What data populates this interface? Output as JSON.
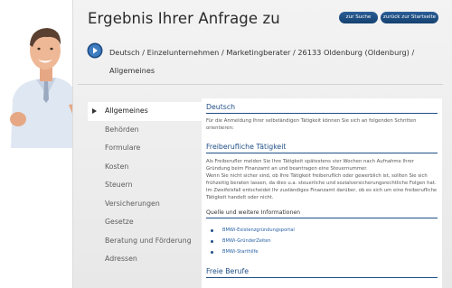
{
  "title": "Ergebnis Ihrer Anfrage zu",
  "buttons": {
    "search": "zur Suche",
    "home": "zurück zur Startseite"
  },
  "breadcrumb": {
    "line1": "Deutsch / Einzelunternehmen / Marketingberater / 26133 Oldenburg (Oldenburg) /",
    "line2": "Allgemeines"
  },
  "nav": {
    "items": [
      {
        "label": "Allgemeines",
        "active": true
      },
      {
        "label": "Behörden"
      },
      {
        "label": "Formulare"
      },
      {
        "label": "Kosten"
      },
      {
        "label": "Steuern"
      },
      {
        "label": "Versicherungen"
      },
      {
        "label": "Gesetze"
      },
      {
        "label": "Beratung und Förderung"
      },
      {
        "label": "Adressen"
      }
    ]
  },
  "content": {
    "section1": {
      "heading": "Deutsch",
      "text": "Für die Anmeldung Ihrer selbständigen Tätigkeit können Sie sich an folgenden Schritten orientieren:"
    },
    "section2": {
      "heading": "Freiberufliche Tätigkeit",
      "text1": "Als Freiberufler melden Sie Ihre Tätigkeit spätestens vier Wochen nach Aufnahme Ihrer Gründung beim Finanzamt an und beantragen eine Steuernummer.",
      "text2": "Wenn Sie nicht sicher sind, ob Ihre Tätigkeit freiberuflich oder gewerblich ist, sollten Sie sich frühzeitig beraten lassen, da dies u.a. steuerliche und sozialversicherungsrechtliche Folgen hat. Im Zweifelsfall entscheidet Ihr zuständiges Finanzamt darüber, ob es sich um eine freiberufliche Tätigkeit handelt oder nicht."
    },
    "section3": {
      "heading": "Quelle und weitere Informationen",
      "links": [
        "BMWi-Existenzgründungsportal",
        "BMWi-GründerZeiten",
        "BMWi-Starthilfe"
      ]
    },
    "section4": {
      "heading": "Freie Berufe"
    }
  },
  "colors": {
    "accent": "#1f4e86",
    "button": "#1b4a7e",
    "link": "#2a62a5"
  },
  "icons": {
    "breadcrumb": "arrow-circle-icon",
    "nav_active": "triangle-right-icon",
    "link_bullet": "bullet-icon"
  }
}
